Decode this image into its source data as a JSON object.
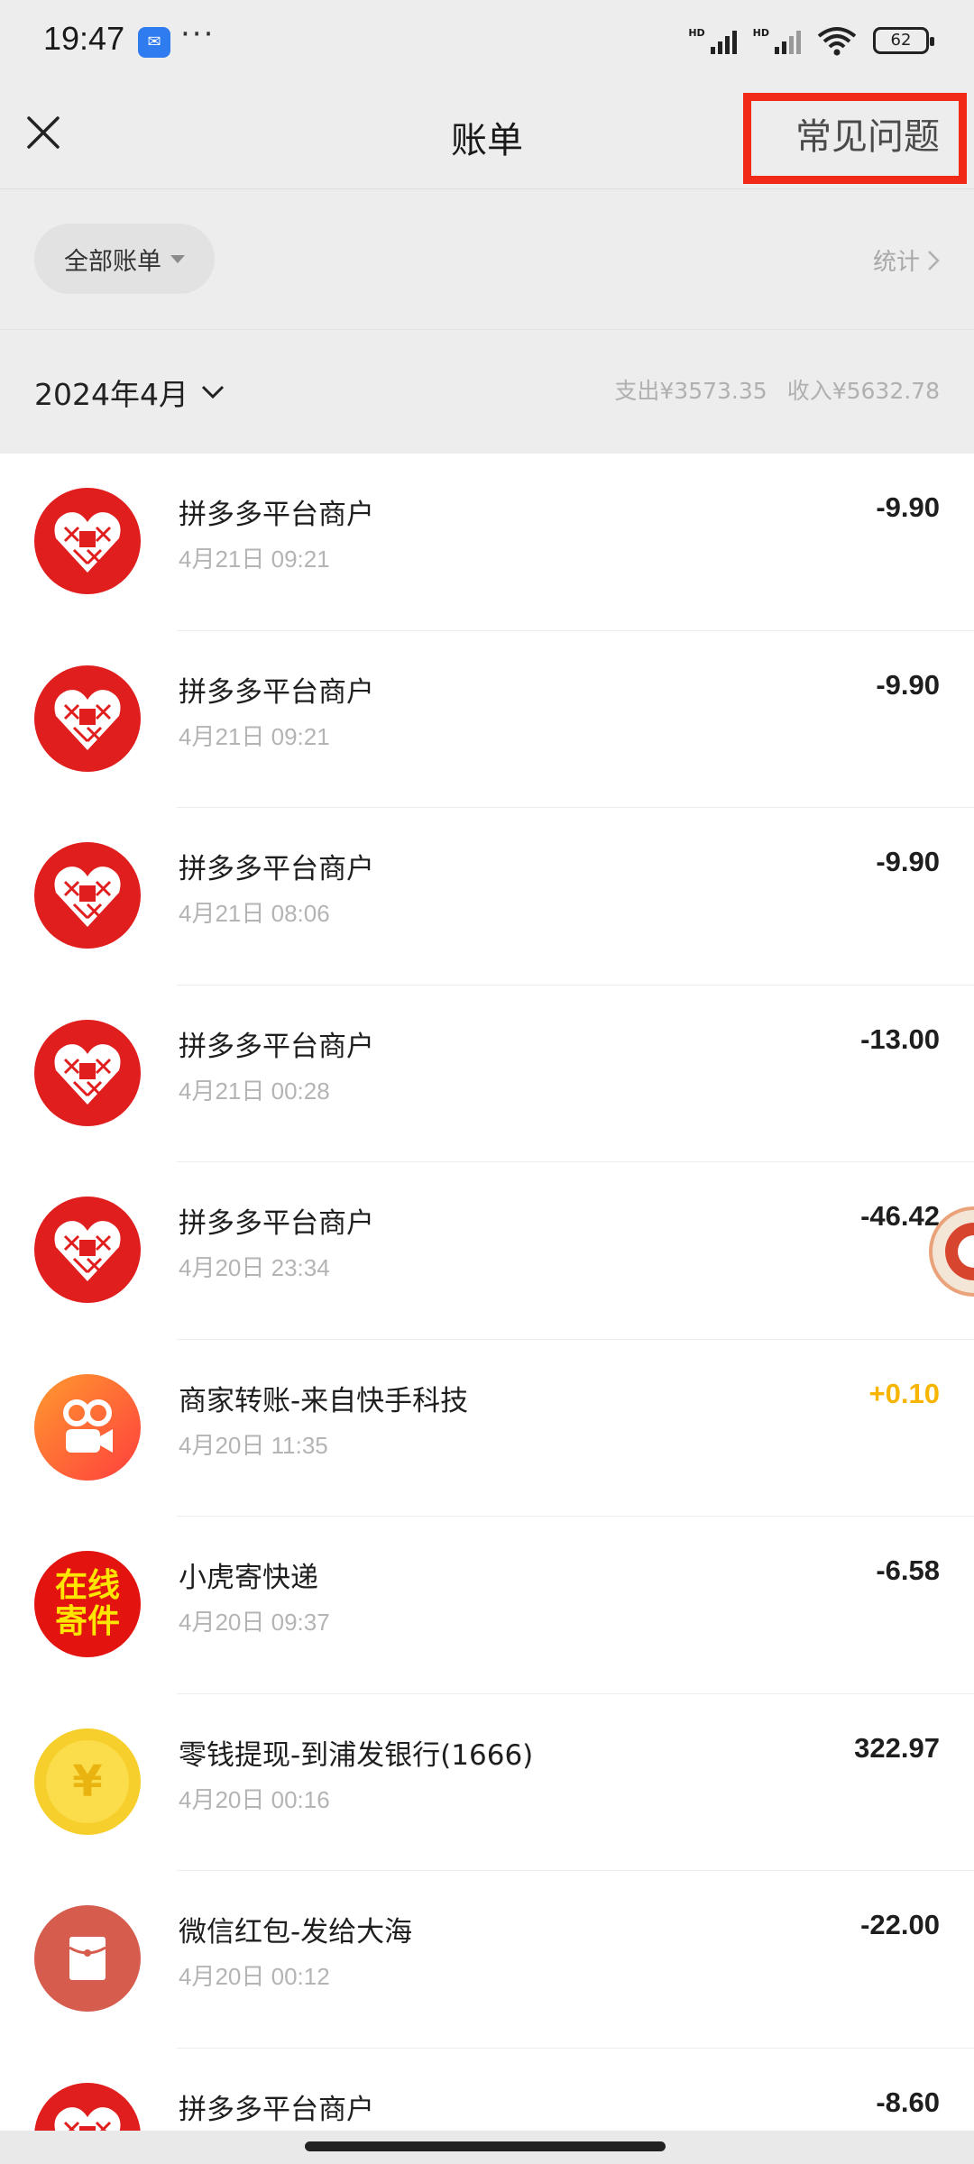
{
  "status_bar": {
    "time": "19:47",
    "dots": "···",
    "battery": "62"
  },
  "header": {
    "title": "账单",
    "faq": "常见问题"
  },
  "filter": {
    "chip_label": "全部账单",
    "stats_label": "统计"
  },
  "month": {
    "label": "2024年4月",
    "expense": "支出¥3573.35",
    "income": "收入¥5632.78"
  },
  "transactions": [
    {
      "merchant": "拼多多平台商户",
      "time": "4月21日 09:21",
      "amount": "-9.90",
      "icon": "pinduoduo-icon"
    },
    {
      "merchant": "拼多多平台商户",
      "time": "4月21日 09:21",
      "amount": "-9.90",
      "icon": "pinduoduo-icon"
    },
    {
      "merchant": "拼多多平台商户",
      "time": "4月21日 08:06",
      "amount": "-9.90",
      "icon": "pinduoduo-icon"
    },
    {
      "merchant": "拼多多平台商户",
      "time": "4月21日 00:28",
      "amount": "-13.00",
      "icon": "pinduoduo-icon"
    },
    {
      "merchant": "拼多多平台商户",
      "time": "4月20日 23:34",
      "amount": "-46.42",
      "icon": "pinduoduo-icon"
    },
    {
      "merchant": "商家转账-来自快手科技",
      "time": "4月20日 11:35",
      "amount": "+0.10",
      "icon": "kuaishou-icon"
    },
    {
      "merchant": "小虎寄快递",
      "time": "4月20日 09:37",
      "amount": "-6.58",
      "icon": "parcel-icon",
      "icon_text_1": "在线",
      "icon_text_2": "寄件"
    },
    {
      "merchant": "零钱提现-到浦发银行(1666)",
      "time": "4月20日 00:16",
      "amount": "322.97",
      "icon": "coin-icon",
      "icon_text_1": "¥"
    },
    {
      "merchant": "微信红包-发给大海",
      "time": "4月20日 00:12",
      "amount": "-22.00",
      "icon": "red-packet-icon"
    },
    {
      "merchant": "拼多多平台商户",
      "time": "",
      "amount": "-8.60",
      "icon": "pinduoduo-icon"
    }
  ],
  "colors": {
    "background": "#ededed",
    "income": "#f7b500",
    "annotation": "#f02a16",
    "pinduoduo": "#e01e1e"
  }
}
